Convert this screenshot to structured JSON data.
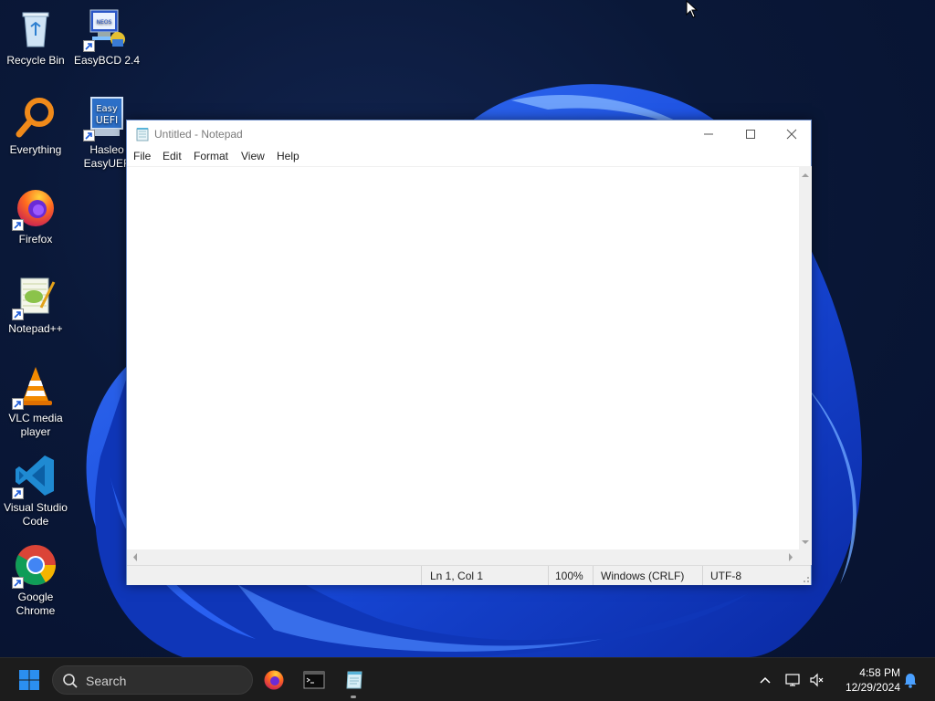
{
  "desktop": {
    "icons": [
      {
        "label": "Recycle Bin",
        "icon": "recycle-bin-icon"
      },
      {
        "label": "EasyBCD 2.4",
        "icon": "easybcd-icon"
      },
      {
        "label": "Everything",
        "icon": "everything-icon"
      },
      {
        "label": "Hasleo EasyUEF",
        "icon": "hasleo-easyuefi-icon"
      },
      {
        "label": "Firefox",
        "icon": "firefox-icon"
      },
      {
        "label": "Notepad++",
        "icon": "notepadpp-icon"
      },
      {
        "label": "VLC media player",
        "icon": "vlc-icon"
      },
      {
        "label": "Visual Studio Code",
        "icon": "vscode-icon"
      },
      {
        "label": "Google Chrome",
        "icon": "chrome-icon"
      }
    ]
  },
  "notepad": {
    "title": "Untitled - Notepad",
    "menu": [
      "File",
      "Edit",
      "Format",
      "View",
      "Help"
    ],
    "content": "",
    "status": {
      "position": "Ln 1, Col 1",
      "zoom": "100%",
      "line_ending": "Windows (CRLF)",
      "encoding": "UTF-8"
    }
  },
  "taskbar": {
    "search_placeholder": "Search",
    "pinned": [
      "firefox-icon",
      "terminal-icon",
      "notepad-icon"
    ],
    "active_app": "notepad-icon",
    "clock": {
      "time": "4:58 PM",
      "date": "12/29/2024"
    }
  },
  "colors": {
    "wallpaper_bg": "#0a1838",
    "wallpaper_bloom": "#1f5cff",
    "taskbar_bg": "#1c1c1c",
    "win_accent": "#2b8ff0"
  }
}
